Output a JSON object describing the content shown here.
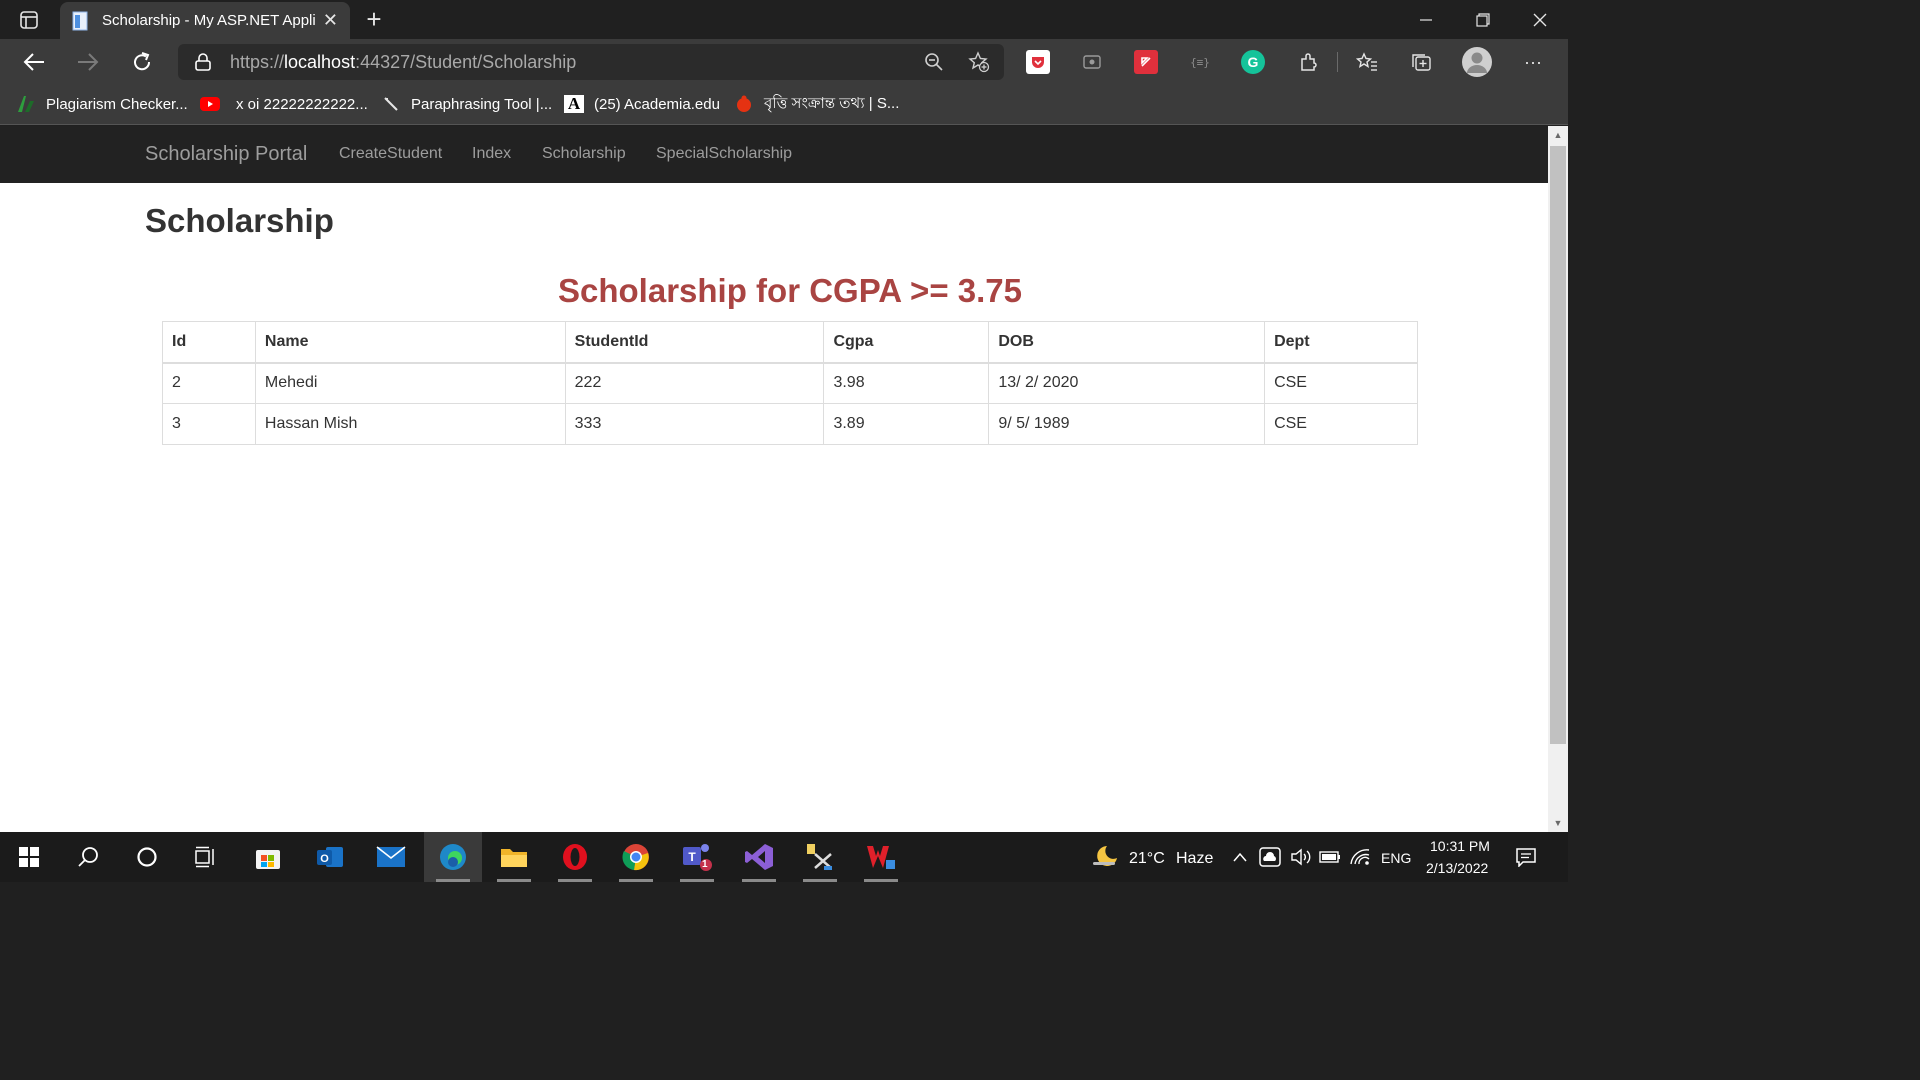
{
  "browser": {
    "tab_title": "Scholarship - My ASP.NET Applic",
    "new_tab_label": "+",
    "url_scheme": "https://",
    "url_host": "localhost",
    "url_rest": ":44327/Student/Scholarship"
  },
  "bookmarks": [
    {
      "label": "Plagiarism Checker...",
      "icon": "plagiarism-icon"
    },
    {
      "label": "x oi 22222222222...",
      "icon": "youtube-icon"
    },
    {
      "label": "Paraphrasing Tool |...",
      "icon": "quill-icon"
    },
    {
      "label": "(25) Academia.edu",
      "icon": "academia-icon"
    },
    {
      "label": "বৃত্তি সংক্রান্ত তথ্য | S...",
      "icon": "ladybug-icon"
    }
  ],
  "navbar": {
    "brand": "Scholarship Portal",
    "links": [
      "CreateStudent",
      "Index",
      "Scholarship",
      "SpecialScholarship"
    ]
  },
  "main": {
    "title": "Scholarship",
    "subtitle": "Scholarship for CGPA >= 3.75",
    "table": {
      "headers": [
        "Id",
        "Name",
        "StudentId",
        "Cgpa",
        "DOB",
        "Dept"
      ],
      "rows": [
        [
          "2",
          "Mehedi",
          "222",
          "3.98",
          "13/ 2/ 2020",
          "CSE"
        ],
        [
          "3",
          "Hassan Mish",
          "333",
          "3.89",
          "9/ 5/ 1989",
          "CSE"
        ]
      ]
    }
  },
  "taskbar": {
    "weather_temp": "21°C",
    "weather_desc": "Haze",
    "language": "ENG",
    "time": "10:31 PM",
    "date": "2/13/2022",
    "teams_badge": "1"
  },
  "colors": {
    "subtitle": "#a94442",
    "navbar_bg": "#222222",
    "browser_bg": "#202020",
    "toolbar_bg": "#3b3b3b"
  }
}
